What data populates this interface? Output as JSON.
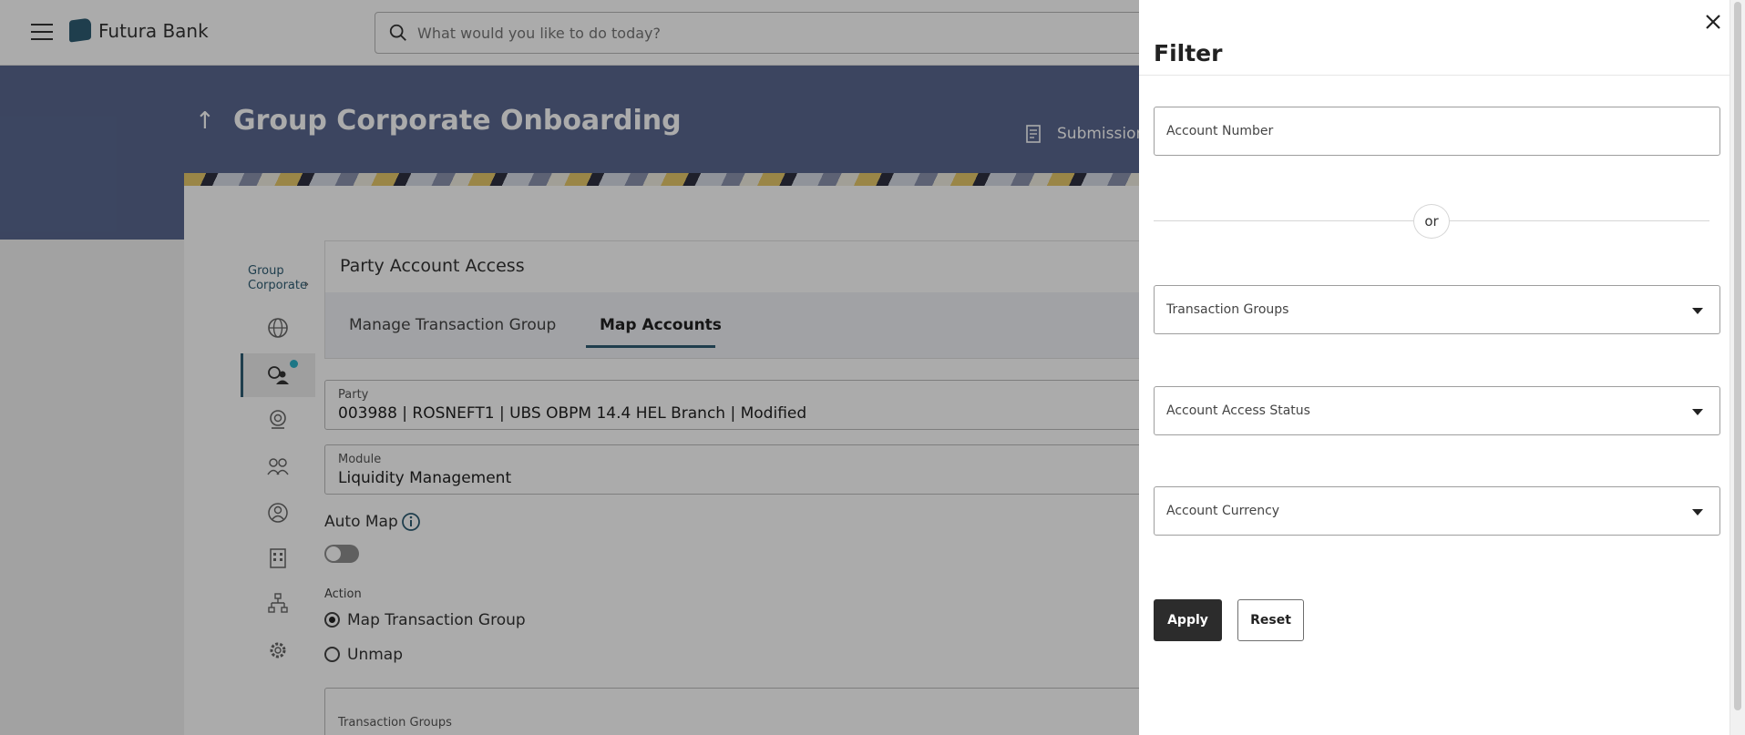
{
  "header": {
    "brand": "Futura Bank",
    "search_placeholder": "What would you like to do today?"
  },
  "banner": {
    "title": "Group Corporate Onboarding",
    "submission_label": "Submission"
  },
  "leftnav": {
    "group_label_line1": "Group",
    "group_label_line2": "Corporate",
    "items": [
      "globe-icon",
      "users-access-icon",
      "badge-icon",
      "group-icon",
      "profile-icon",
      "building-icon",
      "tree-icon",
      "settings-users-icon"
    ]
  },
  "section": {
    "title": "Party Account Access",
    "tabs": [
      {
        "label": "Manage Transaction Group",
        "active": false
      },
      {
        "label": "Map Accounts",
        "active": true
      }
    ]
  },
  "form": {
    "party_label": "Party",
    "party_value": "003988 | ROSNEFT1 | UBS OBPM 14.4 HEL Branch | Modified",
    "module_label": "Module",
    "module_value": "Liquidity Management",
    "automap_label": "Auto Map",
    "automap_on": false,
    "action_label": "Action",
    "action_options": [
      {
        "label": "Map Transaction Group",
        "selected": true
      },
      {
        "label": "Unmap",
        "selected": false
      }
    ],
    "transaction_groups_label": "Transaction Groups"
  },
  "filter": {
    "title": "Filter",
    "account_number_placeholder": "Account Number",
    "or_text": "or",
    "transaction_groups_placeholder": "Transaction Groups",
    "account_access_status_placeholder": "Account Access Status",
    "account_currency_placeholder": "Account Currency",
    "apply_label": "Apply",
    "reset_label": "Reset"
  },
  "colors": {
    "banner": "#5a6890",
    "accent": "#2f5d74",
    "primary_button": "#2c2c2c",
    "notification_dot": "#2cb0c7"
  }
}
